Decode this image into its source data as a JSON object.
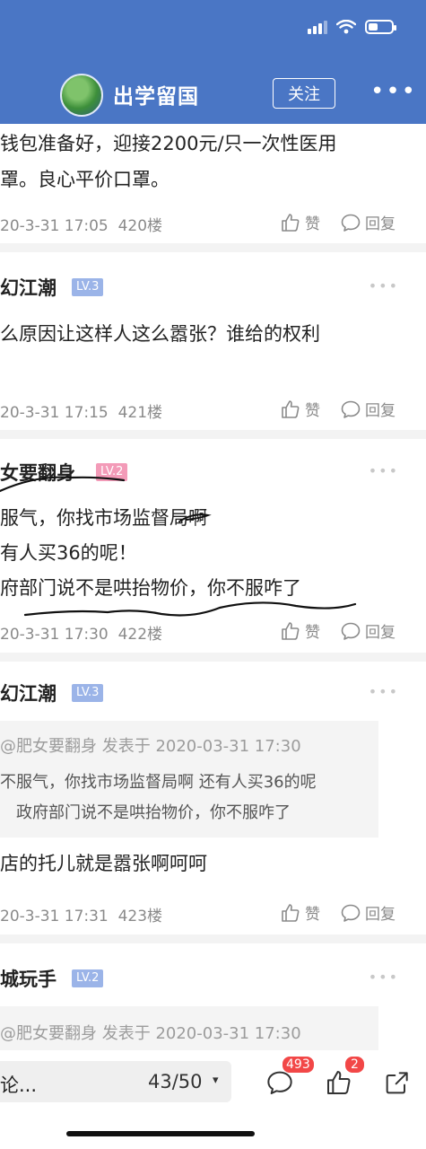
{
  "header": {
    "title": "出学留国",
    "follow_label": "关注",
    "more": "•••"
  },
  "actions": {
    "like": "赞",
    "reply": "回复"
  },
  "posts": [
    {
      "lines": [
        "钱包准备好，迎接2200元/只一次性医用",
        "罩。良心平价口罩。"
      ],
      "time": "20-3-31 17:05",
      "floor": "420楼"
    },
    {
      "user": "幻江潮",
      "level": "LV.3",
      "lines": [
        "么原因让这样人这么嚣张？谁给的权利"
      ],
      "time": "20-3-31 17:15",
      "floor": "421楼"
    },
    {
      "user": "女要翻身",
      "level": "LV.2",
      "lines": [
        "服气，你找市场监督局啊",
        "有人买36的呢！",
        "府部门说不是哄抬物价，你不服咋了"
      ],
      "time": "20-3-31 17:30",
      "floor": "422楼"
    },
    {
      "user": "幻江潮",
      "level": "LV.3",
      "quote_header": "@肥女要翻身  发表于 2020-03-31 17:30",
      "quote_lines": [
        "不服气，你找市场监督局啊 还有人买36的呢",
        "政府部门说不是哄抬物价，你不服咋了"
      ],
      "lines": [
        "店的托儿就是嚣张啊呵呵"
      ],
      "time": "20-3-31 17:31",
      "floor": "423楼"
    },
    {
      "user": "城玩手",
      "level": "LV.2",
      "quote_header": "@肥女要翻身  发表于 2020-03-31 17:30"
    }
  ],
  "bottom_bar": {
    "placeholder": "论...",
    "page_indicator": "43/50",
    "caret": "▾",
    "comment_count": "493",
    "like_count": "2"
  },
  "colors": {
    "header_bg": "#4a76c5",
    "level_blue": "#9bb4e8",
    "level_pink": "#f39bb8",
    "badge_red": "#f24747"
  }
}
